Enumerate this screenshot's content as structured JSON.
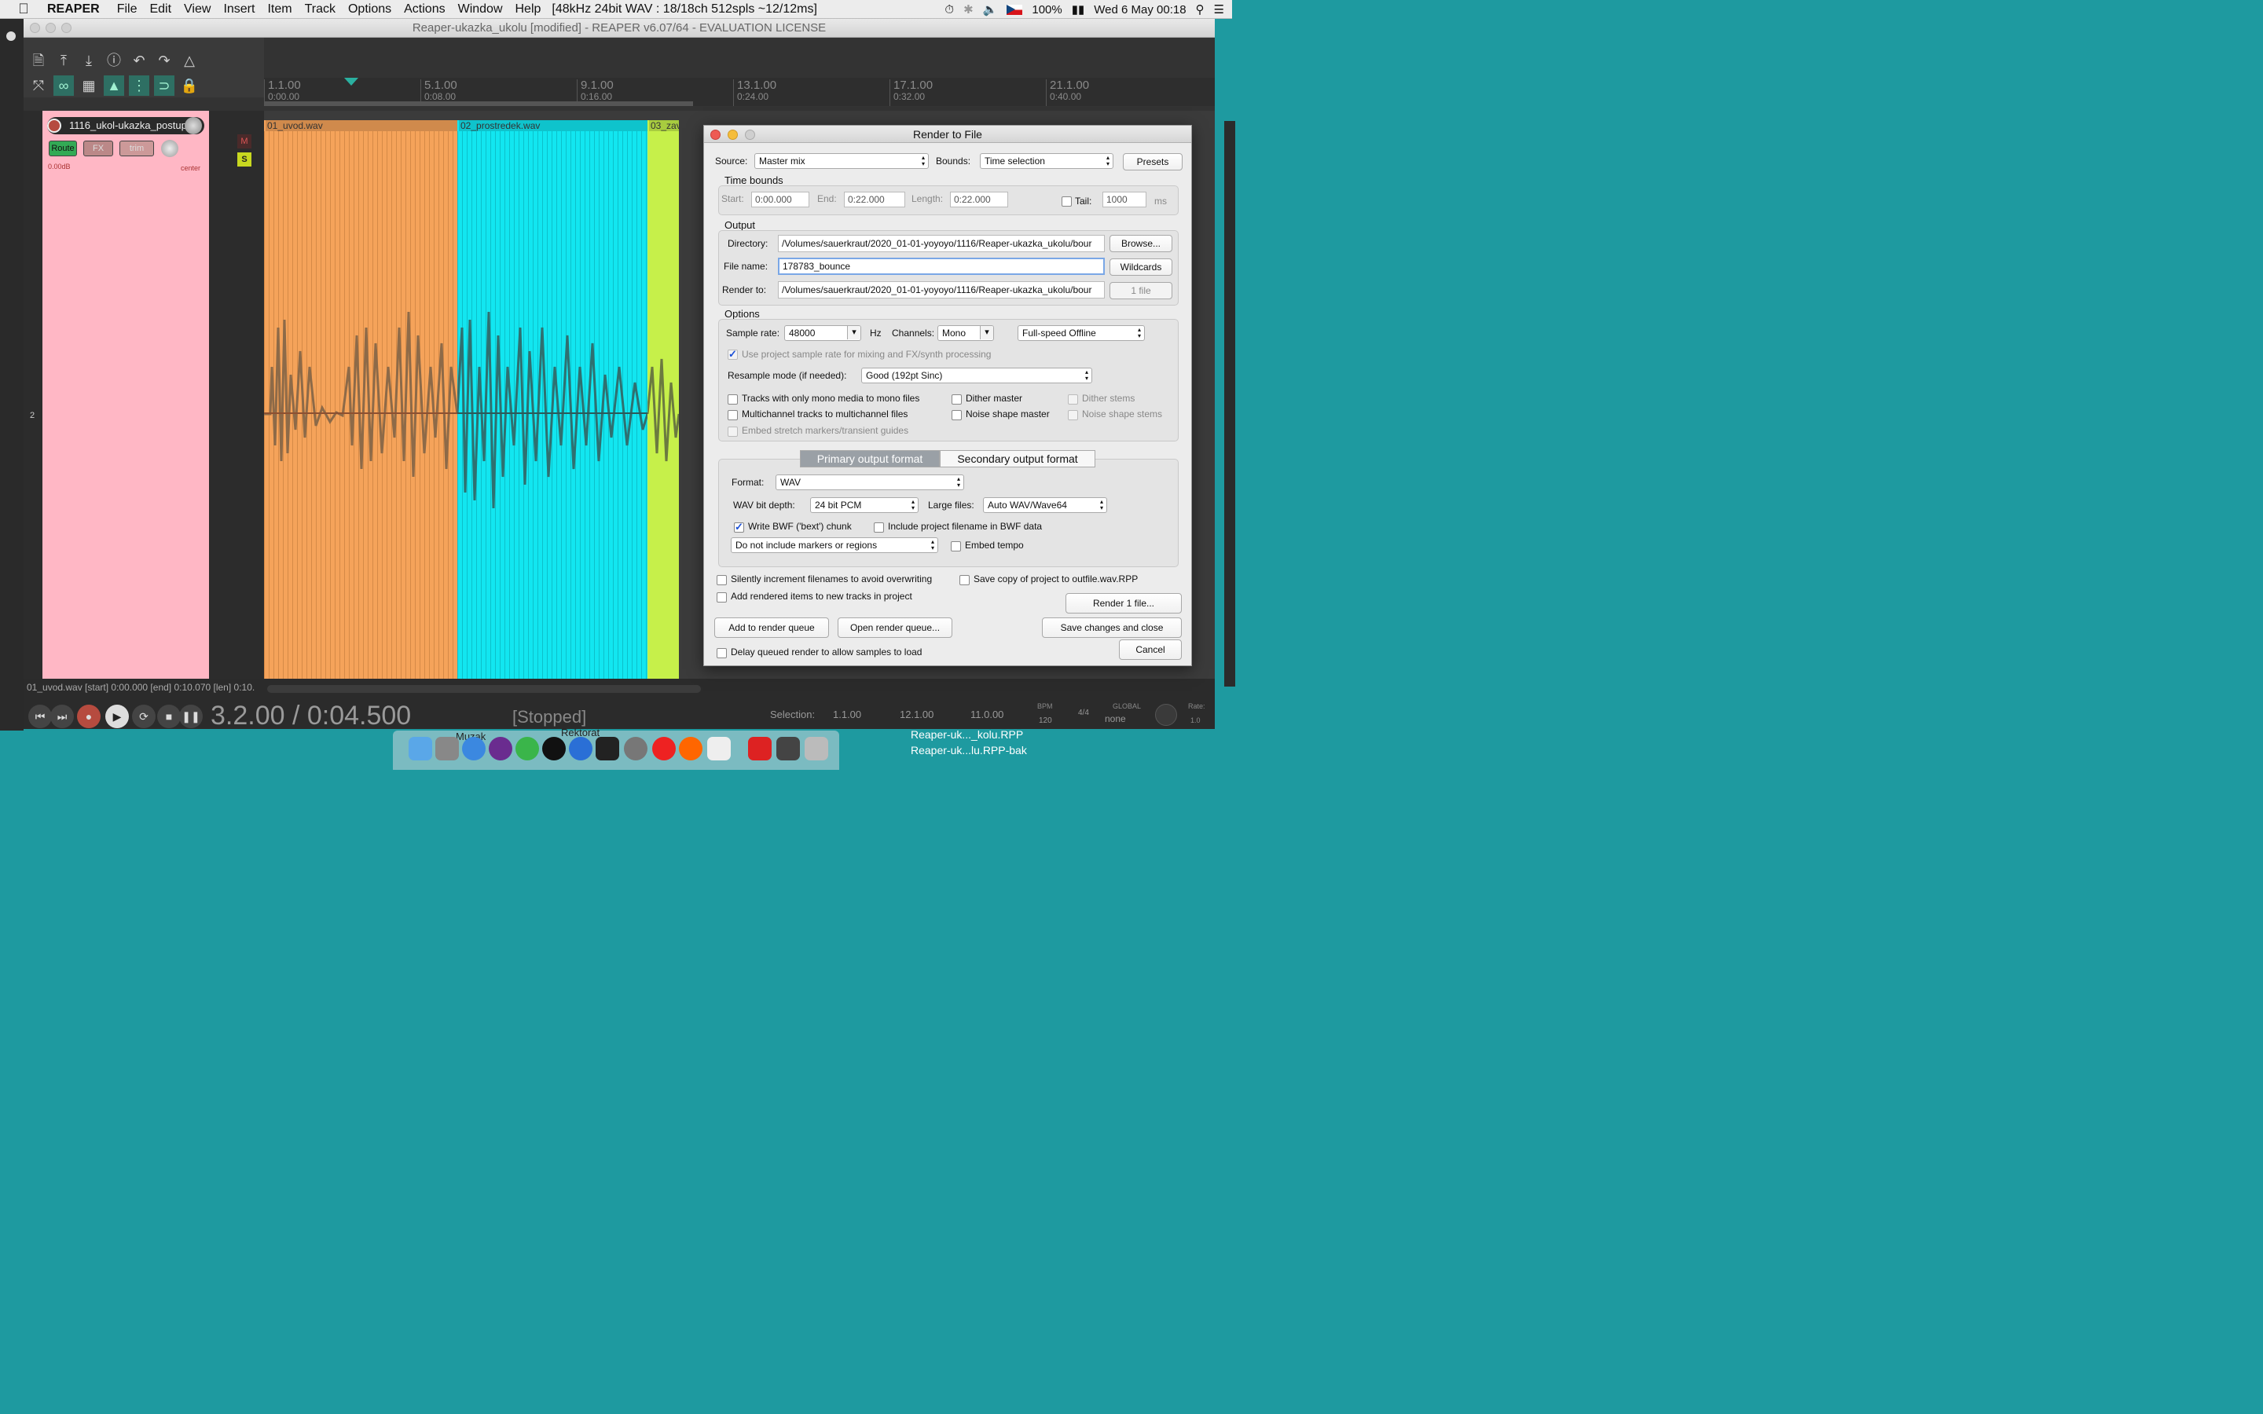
{
  "menubar": {
    "app": "REAPER",
    "items": [
      "File",
      "Edit",
      "View",
      "Insert",
      "Item",
      "Track",
      "Options",
      "Actions",
      "Window",
      "Help"
    ],
    "status": "[48kHz 24bit WAV : 18/18ch 512spls ~12/12ms]",
    "battery": "100%",
    "datetime": "Wed 6 May  00:18"
  },
  "window": {
    "title": "Reaper-ukazka_ukolu [modified] - REAPER v6.07/64 - EVALUATION LICENSE"
  },
  "ruler": [
    {
      "bar": "1.1.00",
      "time": "0:00.00"
    },
    {
      "bar": "5.1.00",
      "time": "0:08.00"
    },
    {
      "bar": "9.1.00",
      "time": "0:16.00"
    },
    {
      "bar": "13.1.00",
      "time": "0:24.00"
    },
    {
      "bar": "17.1.00",
      "time": "0:32.00"
    },
    {
      "bar": "21.1.00",
      "time": "0:40.00"
    }
  ],
  "track": {
    "name": "1116_ukol-ukazka_postup",
    "route": "Route",
    "fx": "FX",
    "trim": "trim",
    "volume": "0.00dB",
    "pan": "center",
    "number": "2",
    "mute": "M",
    "solo": "S"
  },
  "items": [
    {
      "name": "01_uvod.wav",
      "color": "#f5a35a"
    },
    {
      "name": "02_prostredek.wav",
      "color": "#12e6f0"
    },
    {
      "name": "03_zav",
      "color": "#c6f04a"
    }
  ],
  "transport": {
    "status_line": "01_uvod.wav [start] 0:00.000 [end] 0:10.070 [len] 0:10.",
    "position": "3.2.00 / 0:04.500",
    "state": "[Stopped]",
    "selection_label": "Selection:",
    "sel_start": "1.1.00",
    "sel_end": "12.1.00",
    "sel_len": "11.0.00",
    "bpm_label": "BPM",
    "bpm": "120",
    "sig": "4/4",
    "global": "GLOBAL",
    "global_val": "none",
    "rate_label": "Rate:",
    "rate": "1.0"
  },
  "dialog": {
    "title": "Render to File",
    "source_label": "Source:",
    "source": "Master mix",
    "bounds_label": "Bounds:",
    "bounds": "Time selection",
    "presets": "Presets",
    "timebounds": "Time bounds",
    "start_label": "Start:",
    "start": "0:00.000",
    "end_label": "End:",
    "end": "0:22.000",
    "length_label": "Length:",
    "length": "0:22.000",
    "tail_label": "Tail:",
    "tail": "1000",
    "ms": "ms",
    "output": "Output",
    "dir_label": "Directory:",
    "dir": "/Volumes/sauerkraut/2020_01-01-yoyoyo/1116/Reaper-ukazka_ukolu/bour",
    "browse": "Browse...",
    "file_label": "File name:",
    "file": "178783_bounce",
    "wildcards": "Wildcards",
    "renderto_label": "Render to:",
    "renderto": "/Volumes/sauerkraut/2020_01-01-yoyoyo/1116/Reaper-ukazka_ukolu/bour",
    "onefile": "1 file",
    "options": "Options",
    "sr_label": "Sample rate:",
    "sr": "48000",
    "hz": "Hz",
    "ch_label": "Channels:",
    "ch": "Mono",
    "speed": "Full-speed Offline",
    "use_project_sr": "Use project sample rate for mixing and FX/synth processing",
    "resample_label": "Resample mode (if needed):",
    "resample": "Good (192pt Sinc)",
    "mono_files": "Tracks with only mono media to mono files",
    "dither_master": "Dither master",
    "dither_stems": "Dither stems",
    "multichannel": "Multichannel tracks to multichannel files",
    "noise_master": "Noise shape master",
    "noise_stems": "Noise shape stems",
    "embed_stretch": "Embed stretch markers/transient guides",
    "tab_primary": "Primary output format",
    "tab_secondary": "Secondary output format",
    "format_label": "Format:",
    "format": "WAV",
    "bitdepth_label": "WAV bit depth:",
    "bitdepth": "24 bit PCM",
    "large_label": "Large files:",
    "large": "Auto WAV/Wave64",
    "bwf": "Write BWF ('bext') chunk",
    "include_proj": "Include project filename in BWF data",
    "markers": "Do not include markers or regions",
    "embed_tempo": "Embed tempo",
    "increment": "Silently increment filenames to avoid overwriting",
    "save_copy": "Save copy of project to outfile.wav.RPP",
    "add_tracks": "Add rendered items to new tracks in project",
    "render_btn": "Render 1 file...",
    "add_queue": "Add to render queue",
    "open_queue": "Open render queue...",
    "save_close": "Save changes and close",
    "delay": "Delay queued render to allow samples to load",
    "cancel": "Cancel"
  },
  "dock": {
    "folder1": "Muzak",
    "folder2": "Rektorat"
  },
  "desktop": [
    "Reaper-uk..._kolu.RPP",
    "Reaper-uk...lu.RPP-bak"
  ],
  "colors": {
    "track": "#ffb7c5",
    "item1": "#f5a35a",
    "item2": "#12e6f0",
    "item3": "#c6f04a"
  }
}
